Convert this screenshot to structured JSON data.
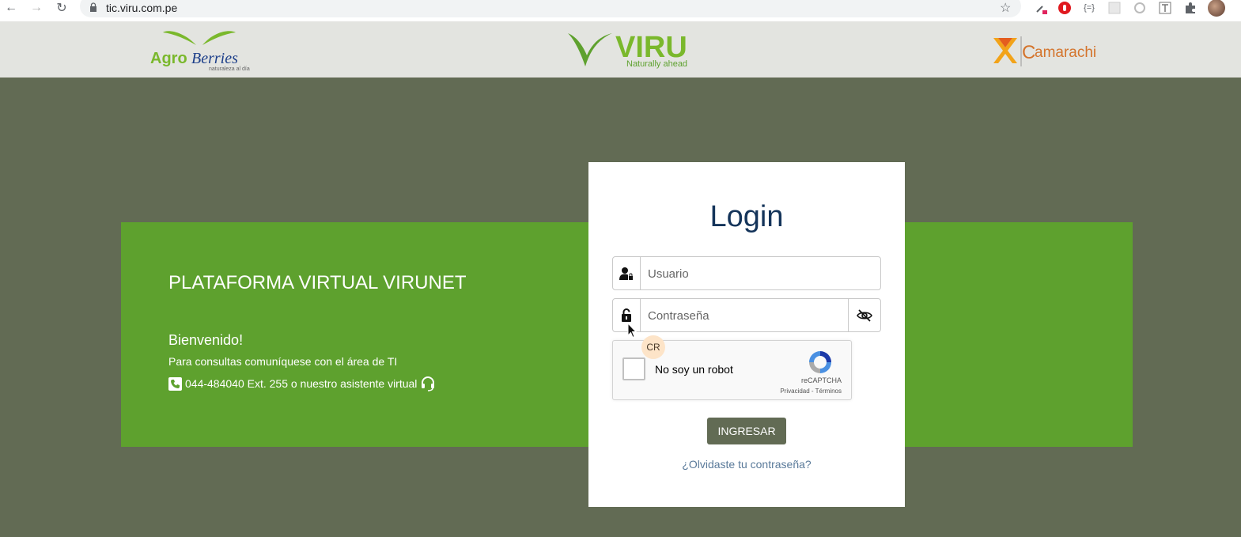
{
  "browser": {
    "url": "tic.viru.com.pe"
  },
  "logos": {
    "agro_name": "AgroBerries",
    "agro_tagline": "naturaleza al día",
    "viru_name": "VIRU",
    "viru_tagline": "Naturally ahead",
    "camarachi_name": "Camarachi"
  },
  "banner": {
    "title": "PLATAFORMA VIRTUAL VIRUNET",
    "welcome": "Bienvenido!",
    "contact": "Para consultas comuníquese con el área de TI",
    "phone_line": "044-484040 Ext. 255 o nuestro asistente virtual"
  },
  "login": {
    "title": "Login",
    "username_placeholder": "Usuario",
    "password_placeholder": "Contraseña",
    "captcha_label": "No soy un robot",
    "captcha_brand": "reCAPTCHA",
    "captcha_links": "Privacidad - Términos",
    "captcha_badge": "CR",
    "submit_label": "INGRESAR",
    "forgot_label": "¿Olvidaste tu contraseña?"
  },
  "colors": {
    "page_bg": "#626b54",
    "banner_green": "#5ea12e",
    "title_blue": "#14345a",
    "button_bg": "#626b54"
  }
}
